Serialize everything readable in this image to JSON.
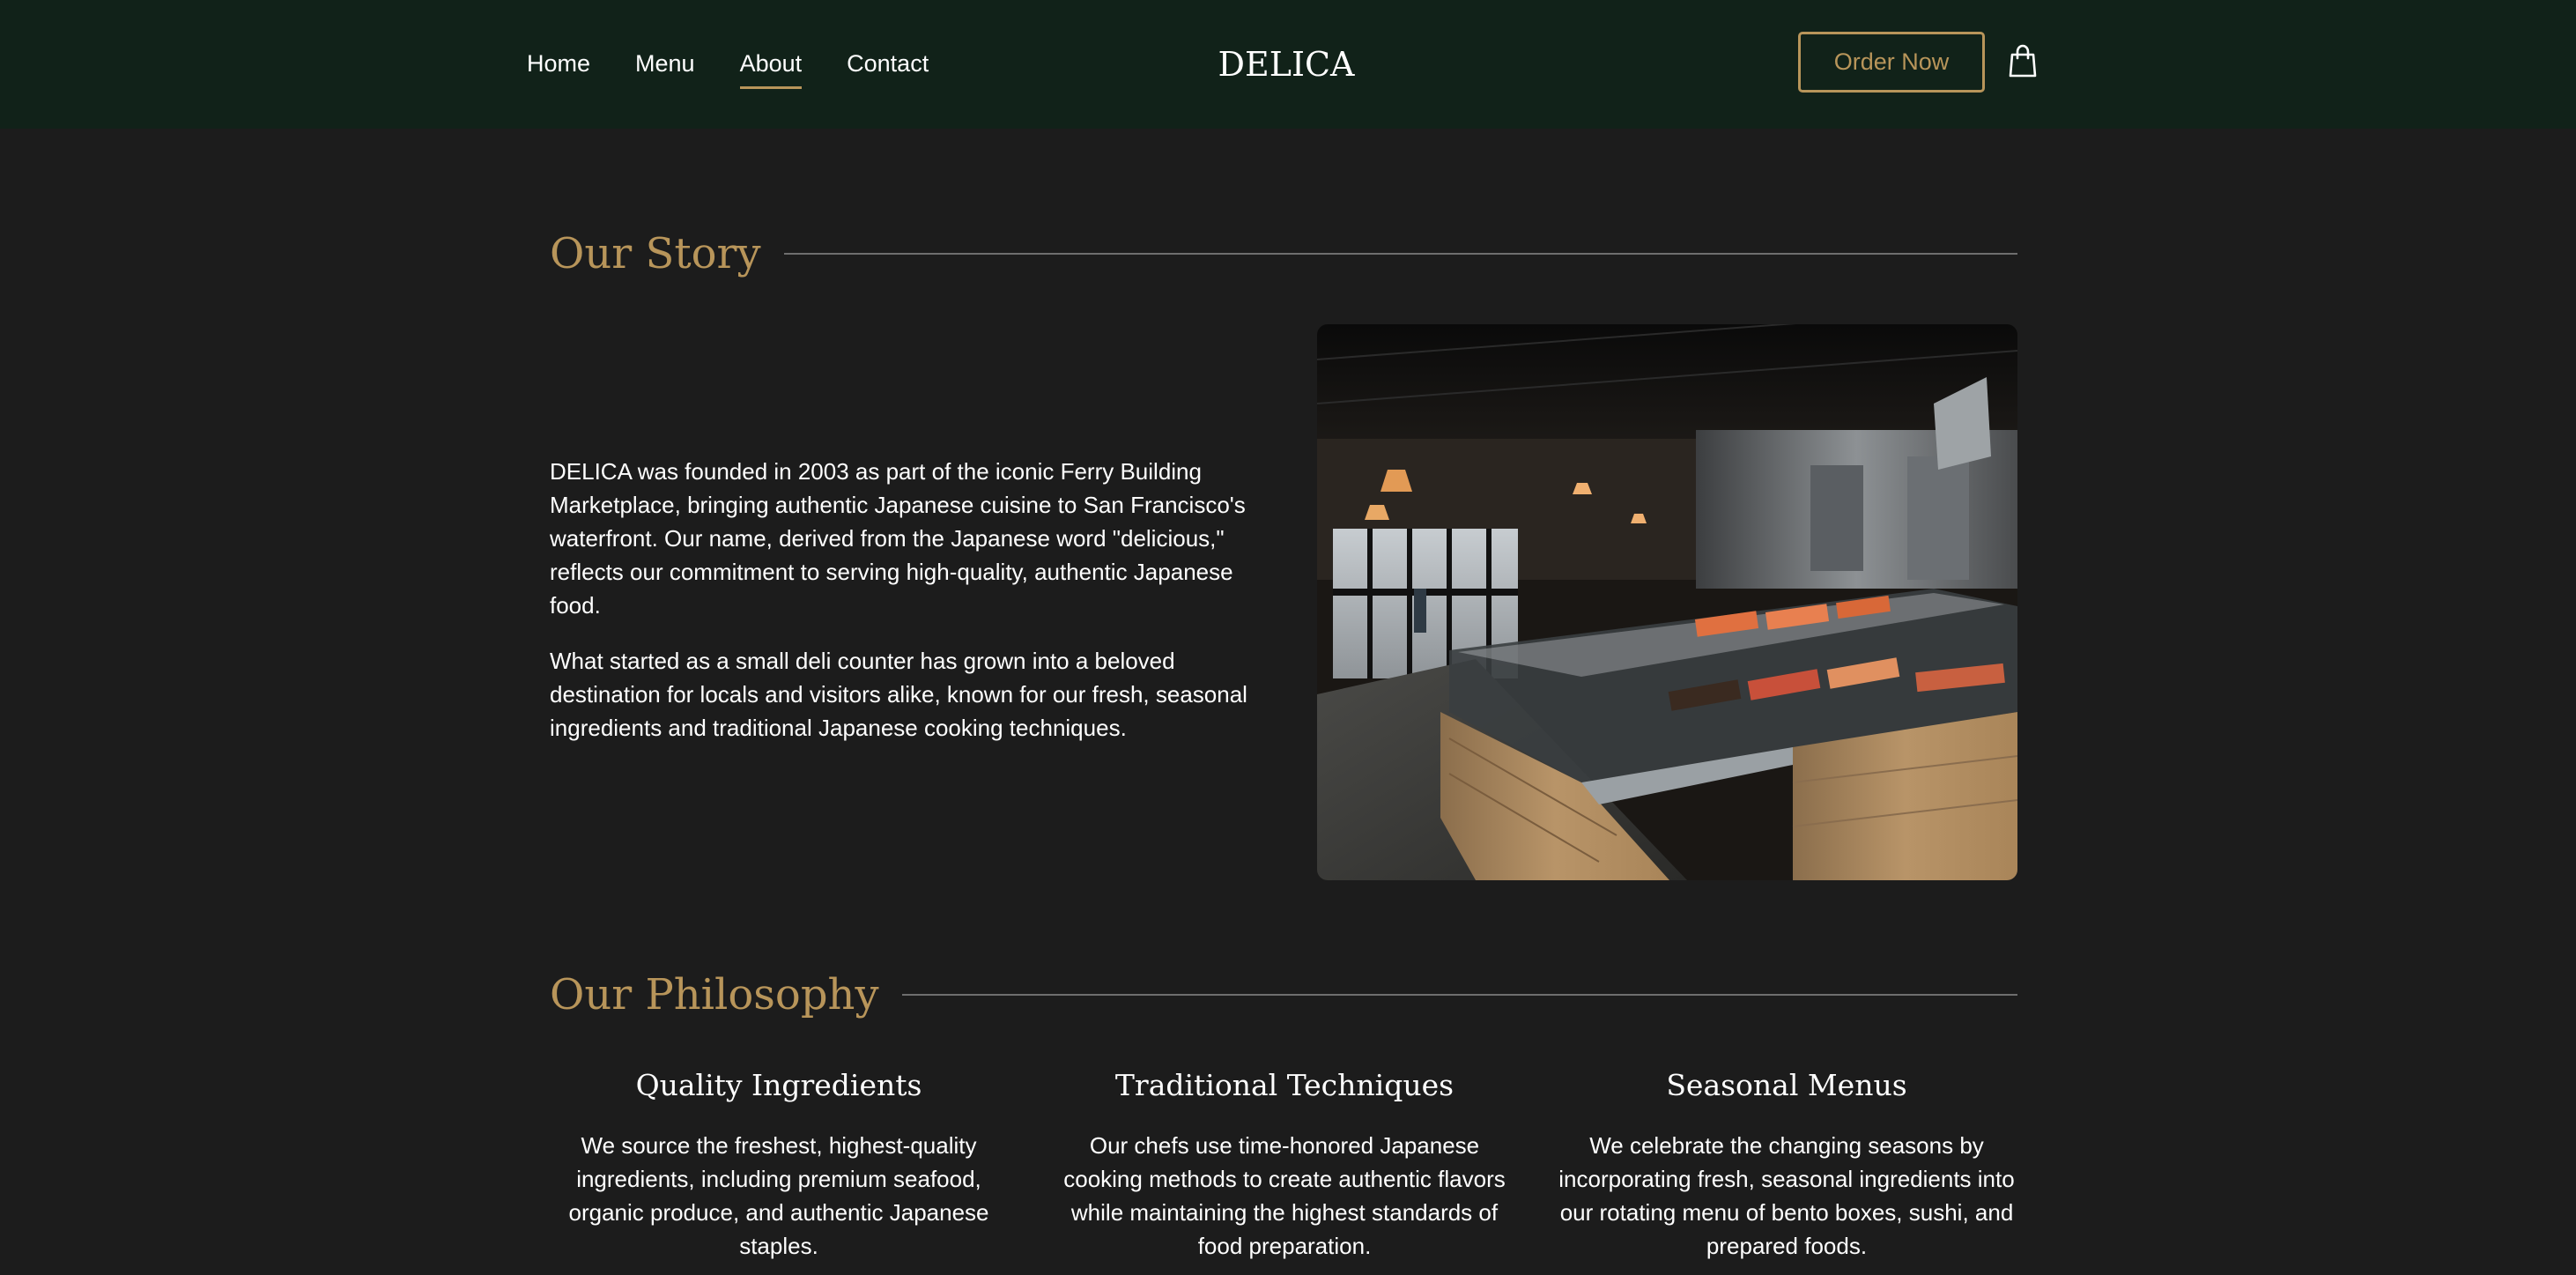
{
  "nav": {
    "links": [
      "Home",
      "Menu",
      "About",
      "Contact"
    ],
    "active": "About",
    "brand": "DELICA",
    "order_button": "Order Now",
    "cart_icon": "shopping-bag-icon"
  },
  "story": {
    "heading": "Our Story",
    "paragraphs": [
      "DELICA was founded in 2003 as part of the iconic Ferry Building Marketplace, bringing authentic Japanese cuisine to San Francisco's waterfront. Our name, derived from the Japanese word \"delicious,\" reflects our commitment to serving high-quality, authentic Japanese food.",
      "What started as a small deli counter has grown into a beloved destination for locals and visitors alike, known for our fresh, seasonal ingredients and traditional Japanese cooking techniques."
    ]
  },
  "philosophy": {
    "heading": "Our Philosophy",
    "items": [
      {
        "title": "Quality Ingredients",
        "text": "We source the freshest, highest-quality ingredients, including premium seafood, organic produce, and authentic Japanese staples."
      },
      {
        "title": "Traditional Techniques",
        "text": "Our chefs use time-honored Japanese cooking methods to create authentic flavors while maintaining the highest standards of food preparation."
      },
      {
        "title": "Seasonal Menus",
        "text": "We celebrate the changing seasons by incorporating fresh, seasonal ingredients into our rotating menu of bento boxes, sushi, and prepared foods."
      }
    ]
  },
  "colors": {
    "nav_bg": "#112219",
    "page_bg": "#1c1c1c",
    "accent": "#b8955a"
  }
}
